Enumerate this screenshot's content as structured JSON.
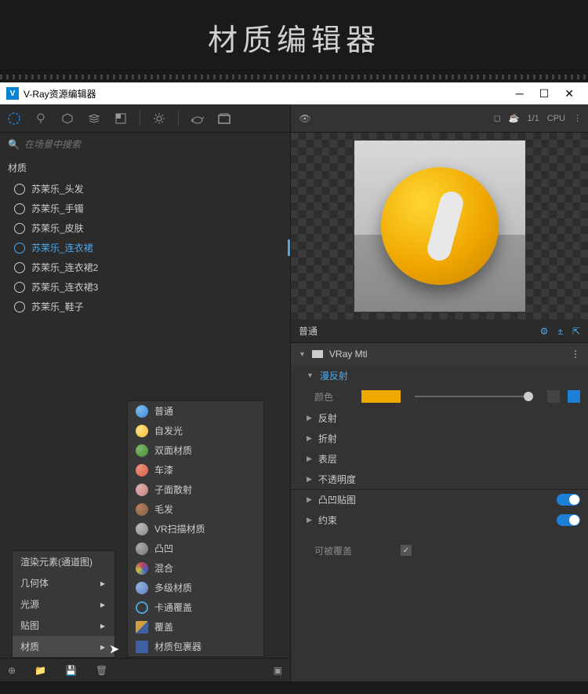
{
  "page_title": "材质编辑器",
  "window": {
    "title": "V-Ray资源编辑器",
    "icon_text": "V"
  },
  "search": {
    "placeholder": "在场景中搜索"
  },
  "section_header": "材质",
  "materials": [
    {
      "label": "苏茉乐_头发",
      "selected": false
    },
    {
      "label": "苏茉乐_手镯",
      "selected": false
    },
    {
      "label": "苏茉乐_皮肤",
      "selected": false
    },
    {
      "label": "苏茉乐_连衣裙",
      "selected": true
    },
    {
      "label": "苏茉乐_连衣裙2",
      "selected": false
    },
    {
      "label": "苏茉乐_连衣裙3",
      "selected": false
    },
    {
      "label": "苏茉乐_鞋子",
      "selected": false
    }
  ],
  "context_menu": [
    {
      "label": "渲染元素(通道图)"
    },
    {
      "label": "几何体"
    },
    {
      "label": "光源"
    },
    {
      "label": "贴图"
    },
    {
      "label": "材质",
      "active": true
    }
  ],
  "submenu": [
    {
      "label": "普通",
      "color": "#3d8ed6"
    },
    {
      "label": "自发光",
      "color": "#f0c040"
    },
    {
      "label": "双面材质",
      "color": "#4a8a3a"
    },
    {
      "label": "车漆",
      "color": "#d0604a"
    },
    {
      "label": "子面散射",
      "color": "#c08080"
    },
    {
      "label": "毛发",
      "color": "#8a6040"
    },
    {
      "label": "VR扫描材质",
      "color": "#888"
    },
    {
      "label": "凸凹",
      "color": "#777"
    },
    {
      "label": "混合",
      "color": "#c04060"
    },
    {
      "label": "多级材质",
      "color": "#6080c0"
    },
    {
      "label": "卡通覆盖",
      "color": "#50a0d0"
    },
    {
      "label": "覆盖",
      "color": "#d0a040"
    },
    {
      "label": "材质包裹器",
      "color": "#4060a0"
    }
  ],
  "preview_bar": {
    "fraction": "1/1",
    "mode": "CPU"
  },
  "prop_tab": "普通",
  "mtl_name": "VRay Mtl",
  "sections": {
    "diffuse": {
      "label": "漫反射",
      "open": true
    },
    "color_label": "颜色",
    "reflect": "反射",
    "refract": "折射",
    "coat": "表层",
    "opacity": "不透明度",
    "bump": "凸凹贴图",
    "binding": "约束"
  },
  "override": {
    "label": "可被覆盖",
    "checked": true
  }
}
